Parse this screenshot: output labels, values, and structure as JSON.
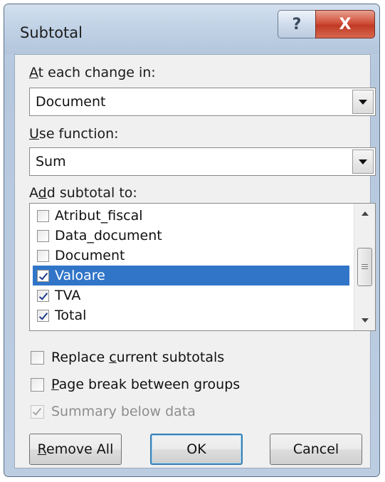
{
  "window": {
    "title": "Subtotal",
    "help_button": "?",
    "close_button": "X"
  },
  "at_each_change": {
    "label_underline": "A",
    "label_rest": "t each change in:",
    "value": "Document"
  },
  "use_function": {
    "label_underline": "U",
    "label_rest": "se function:",
    "value": "Sum"
  },
  "add_subtotal": {
    "label_pre": "A",
    "label_underline": "d",
    "label_rest": "d subtotal to:",
    "items": [
      {
        "label": "Atribut_fiscal",
        "checked": false,
        "selected": false
      },
      {
        "label": "Data_document",
        "checked": false,
        "selected": false
      },
      {
        "label": "Document",
        "checked": false,
        "selected": false
      },
      {
        "label": "Valoare",
        "checked": true,
        "selected": true
      },
      {
        "label": "TVA",
        "checked": true,
        "selected": false
      },
      {
        "label": "Total",
        "checked": true,
        "selected": false
      }
    ]
  },
  "options": {
    "replace_pre": "Replace ",
    "replace_underline": "c",
    "replace_rest": "urrent subtotals",
    "replace_checked": false,
    "pagebreak_underline": "P",
    "pagebreak_rest": "age break between groups",
    "pagebreak_checked": false,
    "summary_label": "Summary below data",
    "summary_checked": true,
    "summary_disabled": true
  },
  "buttons": {
    "remove_all_underline": "R",
    "remove_all_rest": "emove All",
    "ok": "OK",
    "cancel": "Cancel"
  },
  "colors": {
    "selection": "#3075c8",
    "close_button": "#c03a25",
    "default_button_border": "#3c7fb1"
  }
}
